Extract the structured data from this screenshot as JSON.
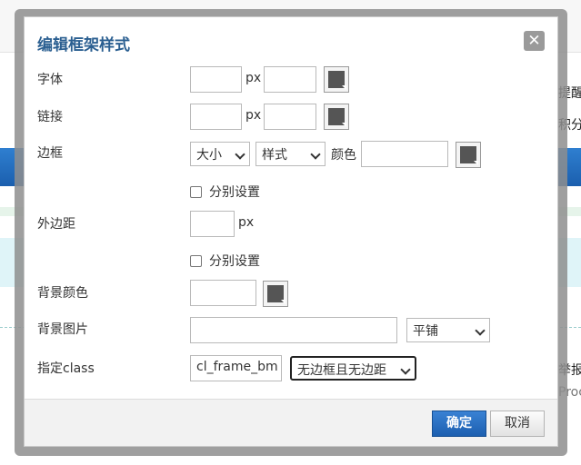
{
  "background": {
    "right_text_1": "提醒 ▼",
    "right_text_2": "积分",
    "right_text_3": "举报",
    "right_text_4": "Proc"
  },
  "dialog": {
    "title": "编辑框架样式",
    "close_glyph": "✕",
    "font": {
      "label": "字体",
      "size_value": "",
      "unit": "px",
      "second_value": ""
    },
    "link": {
      "label": "链接",
      "size_value": "",
      "unit": "px",
      "second_value": ""
    },
    "border": {
      "label": "边框",
      "size_select": "大小",
      "style_select": "样式",
      "color_label": "颜色",
      "color_value": ""
    },
    "separate_1": {
      "label": "分别设置",
      "checked": false
    },
    "margin": {
      "label": "外边距",
      "value": "",
      "unit": "px"
    },
    "separate_2": {
      "label": "分别设置",
      "checked": false
    },
    "bg_color": {
      "label": "背景颜色",
      "value": ""
    },
    "bg_image": {
      "label": "背景图片",
      "value": "",
      "repeat_select": "平铺"
    },
    "class": {
      "label": "指定class",
      "value": "cl_frame_bm",
      "preset_select": "无边框且无边距"
    },
    "swatch_color": "#555555",
    "ok_label": "确定",
    "cancel_label": "取消",
    "accent": "#2b5f91"
  }
}
